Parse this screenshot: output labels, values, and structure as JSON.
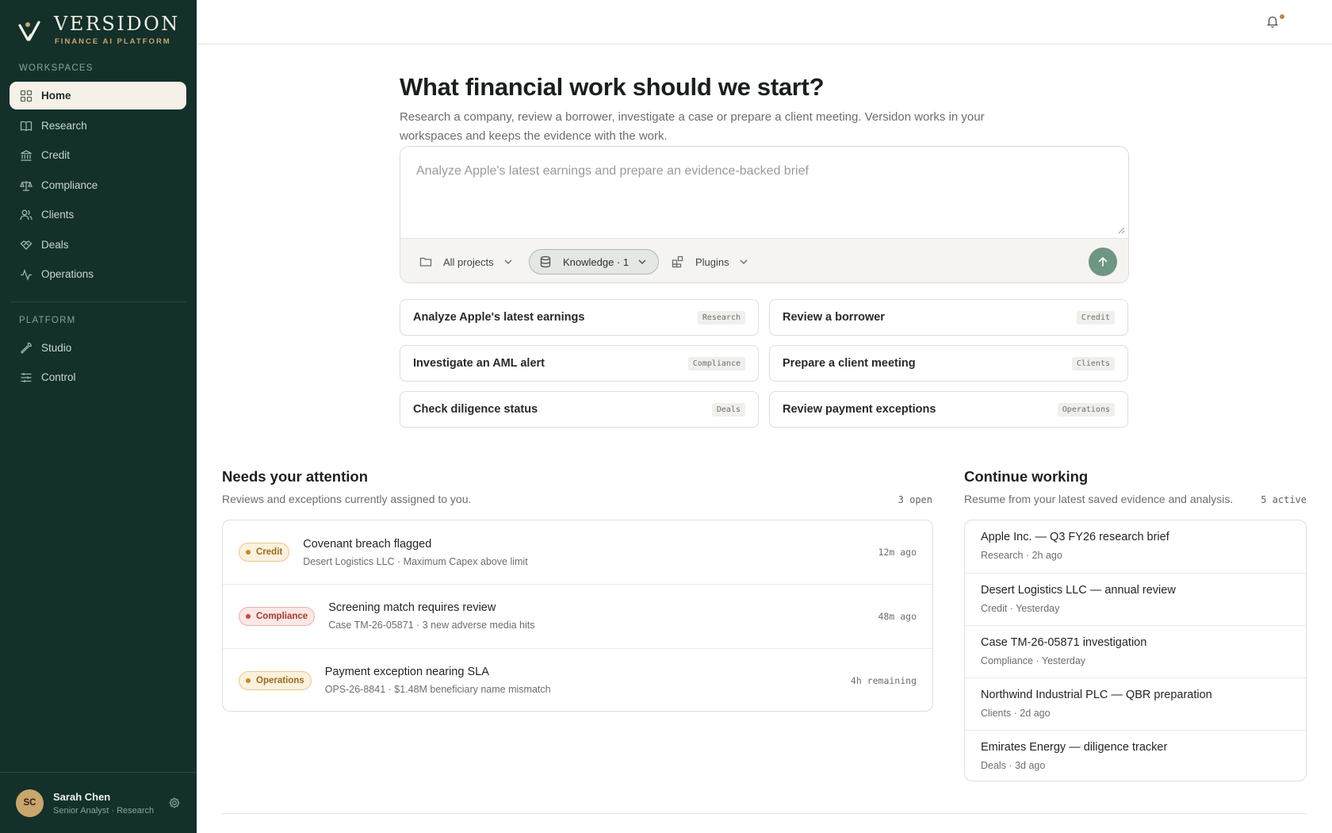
{
  "brand": {
    "name": "VERSIDON",
    "subtitle": "FINANCE AI PLATFORM"
  },
  "sidebar": {
    "workspaces_label": "WORKSPACES",
    "workspaces": [
      {
        "label": "Home",
        "icon": "grid-icon",
        "active": true
      },
      {
        "label": "Research",
        "icon": "book-icon"
      },
      {
        "label": "Credit",
        "icon": "bank-icon"
      },
      {
        "label": "Compliance",
        "icon": "scale-icon"
      },
      {
        "label": "Clients",
        "icon": "users-icon"
      },
      {
        "label": "Deals",
        "icon": "handshake-icon"
      },
      {
        "label": "Operations",
        "icon": "activity-icon"
      }
    ],
    "platform_label": "PLATFORM",
    "platform": [
      {
        "label": "Studio",
        "icon": "wrench-icon"
      },
      {
        "label": "Control",
        "icon": "sliders-icon"
      }
    ]
  },
  "user": {
    "initials": "SC",
    "name": "Sarah Chen",
    "role": "Senior Analyst · Research"
  },
  "hero": {
    "title": "What financial work should we start?",
    "subtitle": "Research a company, review a borrower, investigate a case or prepare a client meeting. Versidon works in your workspaces and keeps the evidence with the work."
  },
  "composer": {
    "placeholder": "Analyze Apple's latest earnings and prepare an evidence-backed brief",
    "projects_label": "All projects",
    "knowledge_label": "Knowledge · 1",
    "plugins_label": "Plugins"
  },
  "suggestions": [
    {
      "label": "Analyze Apple's latest earnings",
      "tag": "Research"
    },
    {
      "label": "Review a borrower",
      "tag": "Credit"
    },
    {
      "label": "Investigate an AML alert",
      "tag": "Compliance"
    },
    {
      "label": "Prepare a client meeting",
      "tag": "Clients"
    },
    {
      "label": "Check diligence status",
      "tag": "Deals"
    },
    {
      "label": "Review payment exceptions",
      "tag": "Operations"
    }
  ],
  "attention": {
    "title": "Needs your attention",
    "subtitle": "Reviews and exceptions currently assigned to you.",
    "count": "3 open",
    "items": [
      {
        "badge": "Credit",
        "title": "Covenant breach flagged",
        "meta": "Desert Logistics LLC · Maximum Capex above limit",
        "time": "12m ago"
      },
      {
        "badge": "Compliance",
        "title": "Screening match requires review",
        "meta": "Case TM-26-05871 · 3 new adverse media hits",
        "time": "48m ago"
      },
      {
        "badge": "Operations",
        "title": "Payment exception nearing SLA",
        "meta": "OPS-26-8841 · $1.48M beneficiary name mismatch",
        "time": "4h remaining"
      }
    ]
  },
  "continue": {
    "title": "Continue working",
    "subtitle": "Resume from your latest saved evidence and analysis.",
    "count": "5 active",
    "items": [
      {
        "title": "Apple Inc. — Q3 FY26 research brief",
        "meta": "Research · 2h ago"
      },
      {
        "title": "Desert Logistics LLC — annual review",
        "meta": "Credit · Yesterday"
      },
      {
        "title": "Case TM-26-05871 investigation",
        "meta": "Compliance · Yesterday"
      },
      {
        "title": "Northwind Industrial PLC — QBR preparation",
        "meta": "Clients · 2d ago"
      },
      {
        "title": "Emirates Energy — diligence tracker",
        "meta": "Deals · 3d ago"
      }
    ]
  },
  "colors": {
    "sidebar_bg": "#13302a",
    "accent_gold": "#c9a66b",
    "send_button": "#6f9583",
    "active_nav_bg": "#f6f1e8"
  }
}
